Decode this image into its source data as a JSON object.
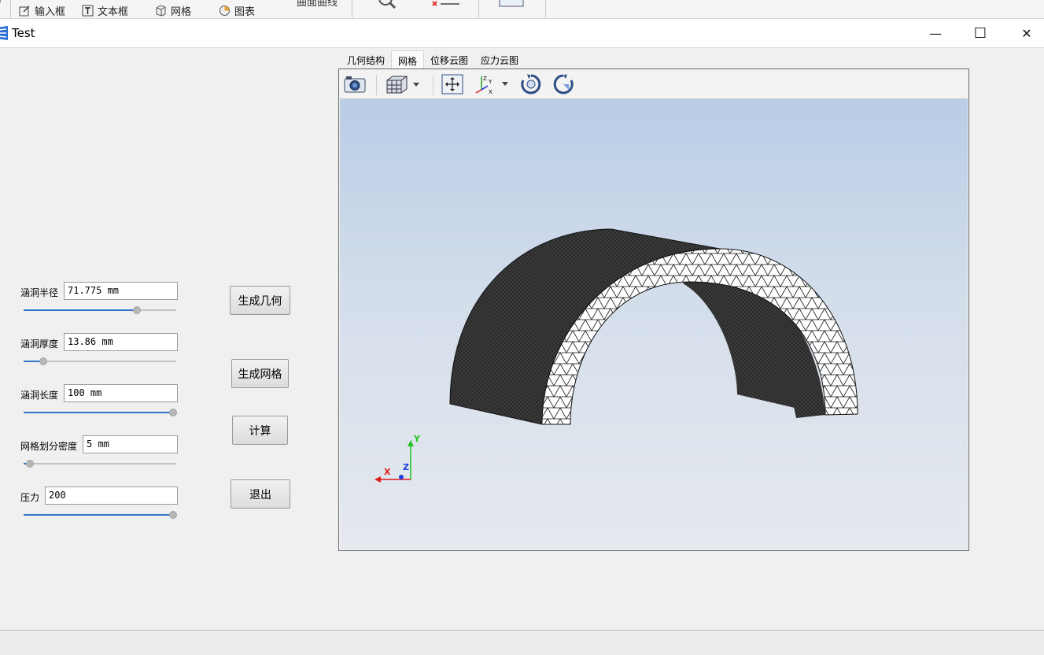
{
  "background_app": {
    "ribbon_items": [
      "输入框",
      "文本框",
      "网格",
      "图表"
    ],
    "ribbon_clipped_text": "曲面曲线"
  },
  "window": {
    "title": "Test",
    "minimize_glyph": "—",
    "maximize_glyph": "☐",
    "close_glyph": "✕"
  },
  "params": {
    "radius": {
      "label": "涵洞半径",
      "value": "71.775 mm",
      "slider_fraction": 0.74
    },
    "thickness": {
      "label": "涵洞厚度",
      "value": "13.86 mm",
      "slider_fraction": 0.13
    },
    "length": {
      "label": "涵洞长度",
      "value": "100 mm",
      "slider_fraction": 0.98
    },
    "mesh_density": {
      "label": "网格划分密度",
      "value": "5 mm",
      "slider_fraction": 0.04
    },
    "pressure": {
      "label": "压力",
      "value": "200",
      "slider_fraction": 0.98
    }
  },
  "actions": {
    "gen_geometry": "生成几何",
    "gen_mesh": "生成网格",
    "compute": "计算",
    "exit": "退出"
  },
  "tabs": [
    "几何结构",
    "网格",
    "位移云图",
    "应力云图"
  ],
  "active_tab": "网格",
  "toolbar_icons": [
    "camera-icon",
    "view-cube-icon",
    "fit-view-icon",
    "axes-icon",
    "rotate-cw-icon",
    "rotate-ccw-icon"
  ],
  "axes_triad": {
    "x": "X",
    "y": "Y",
    "z": "Z"
  },
  "colors": {
    "accent": "#2f76c9",
    "mesh_outer": "#3a3a3a",
    "mesh_face": "#ffffff",
    "axis_x": "#e01b1b",
    "axis_y": "#1fc41f",
    "axis_z": "#1f3fe0"
  }
}
